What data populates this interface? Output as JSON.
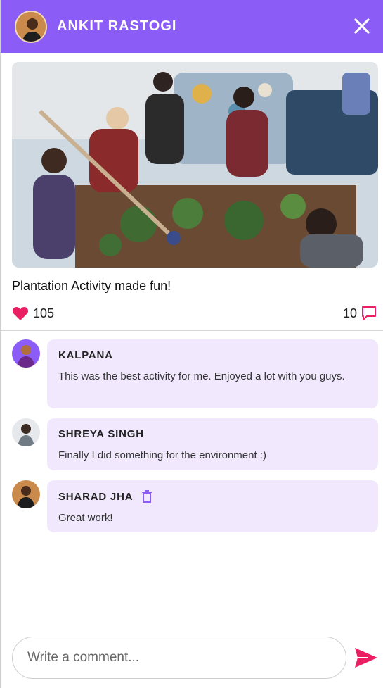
{
  "header": {
    "title": "ANKIT RASTOGI",
    "background": "#8b5cf6"
  },
  "post": {
    "caption": "Plantation Activity made fun!",
    "likes": "105",
    "comments_count": "10",
    "like_color": "#e91e63"
  },
  "comments": [
    {
      "name": "KALPANA",
      "text": "This was the best activity for me. Enjoyed a lot with you guys."
    },
    {
      "name": "SHREYA SINGH",
      "text": "Finally I did something for the environment :)"
    },
    {
      "name": "SHARAD JHA",
      "text": "Great work!"
    }
  ],
  "composer": {
    "placeholder": "Write a comment..."
  },
  "icons": [
    "close-icon",
    "heart-icon",
    "comment-icon",
    "trash-icon",
    "send-icon"
  ]
}
